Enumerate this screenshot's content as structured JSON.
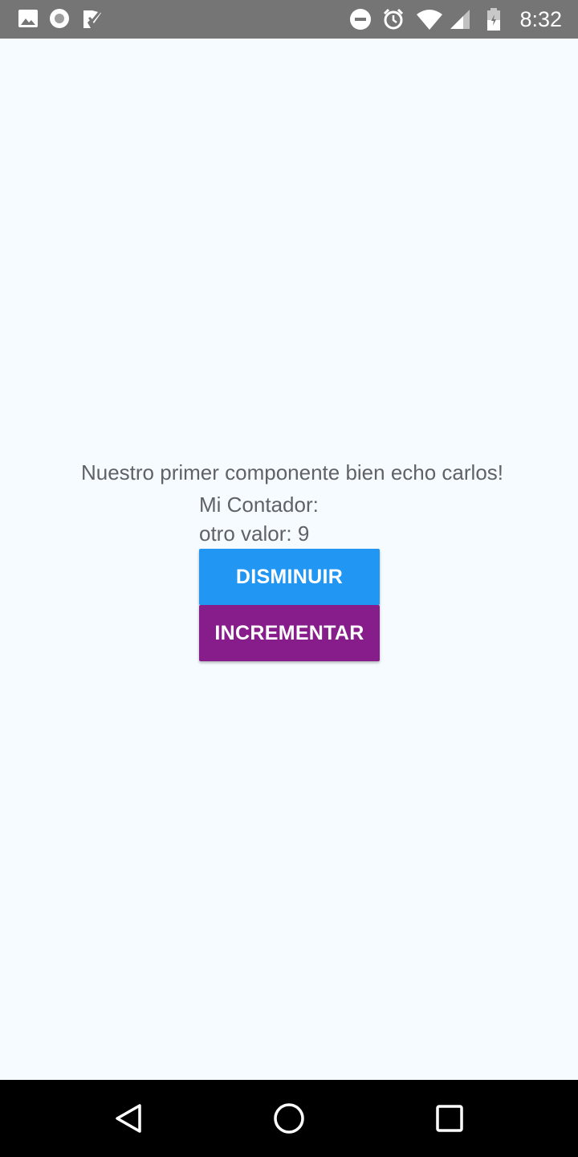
{
  "status_bar": {
    "time": "8:32",
    "left_icons": [
      "image-icon",
      "record-icon",
      "check-badge-icon"
    ],
    "right_icons": [
      "do-not-disturb-icon",
      "alarm-icon",
      "wifi-icon",
      "signal-icon",
      "battery-icon"
    ],
    "background": "#757575"
  },
  "main": {
    "headline": "Nuestro primer componente bien echo carlos!",
    "counter_label": "Mi Contador:",
    "other_value": "otro valor: 9",
    "decrease_label": "DISMINUIR",
    "increase_label": "INCREMENTAR",
    "colors": {
      "decrease": "#2196f3",
      "increase": "#871c8b",
      "background": "#f5fbff",
      "text": "#5f6368"
    }
  },
  "nav_bar": {
    "icons": [
      "back-icon",
      "home-icon",
      "recents-icon"
    ]
  }
}
